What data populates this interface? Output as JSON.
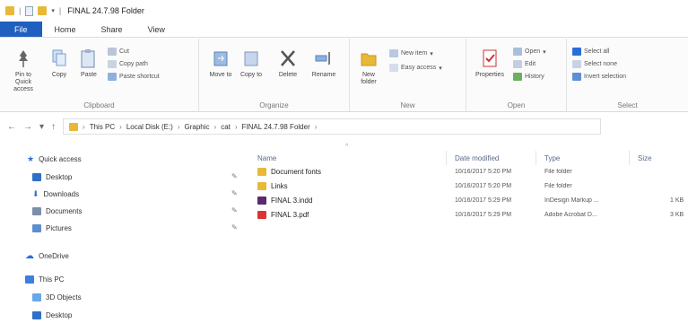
{
  "window": {
    "title": "FINAL 24.7.98 Folder"
  },
  "tabs": [
    "File",
    "Home",
    "Share",
    "View"
  ],
  "ribbon": {
    "clipboard": {
      "label": "Clipboard",
      "pin": "Pin to Quick access",
      "copy": "Copy",
      "paste": "Paste",
      "cut": "Cut",
      "copy_path": "Copy path",
      "paste_shortcut": "Paste shortcut"
    },
    "organize": {
      "label": "Organize",
      "move_to": "Move to",
      "copy_to": "Copy to",
      "delete": "Delete",
      "rename": "Rename"
    },
    "new": {
      "label": "New",
      "new_folder": "New folder",
      "new_item": "New item",
      "easy_access": "Easy access"
    },
    "open": {
      "label": "Open",
      "properties": "Properties",
      "open": "Open",
      "edit": "Edit",
      "history": "History"
    },
    "select": {
      "label": "Select",
      "select_all": "Select all",
      "select_none": "Select none",
      "invert": "Invert selection"
    }
  },
  "address": {
    "segments": [
      "This PC",
      "Local Disk (E:)",
      "Graphic",
      "cat",
      "FINAL 24.7.98 Folder"
    ]
  },
  "nav": [
    {
      "label": "Quick access"
    },
    {
      "label": "Desktop"
    },
    {
      "label": "Downloads"
    },
    {
      "label": "Documents"
    },
    {
      "label": "Pictures"
    },
    {
      "label": "OneDrive"
    },
    {
      "label": "This PC"
    },
    {
      "label": "3D Objects"
    },
    {
      "label": "Desktop"
    }
  ],
  "columns": {
    "name": "Name",
    "date": "Date modified",
    "type": "Type",
    "size": "Size"
  },
  "files": [
    {
      "name": "Document fonts",
      "date": "10/16/2017 5:20 PM",
      "type": "File folder",
      "size": ""
    },
    {
      "name": "Links",
      "date": "10/16/2017 5:20 PM",
      "type": "File folder",
      "size": ""
    },
    {
      "name": "FINAL 3.indd",
      "date": "10/16/2017 5:29 PM",
      "type": "InDesign Markup ...",
      "size": "1 KB"
    },
    {
      "name": "FINAL 3.pdf",
      "date": "10/16/2017 5:29 PM",
      "type": "Adobe Acrobat D...",
      "size": "3 KB"
    }
  ],
  "colors": {
    "file_tab": "#1f5fbf",
    "folder": "#e8b838",
    "accent": "#2a6fd6"
  }
}
